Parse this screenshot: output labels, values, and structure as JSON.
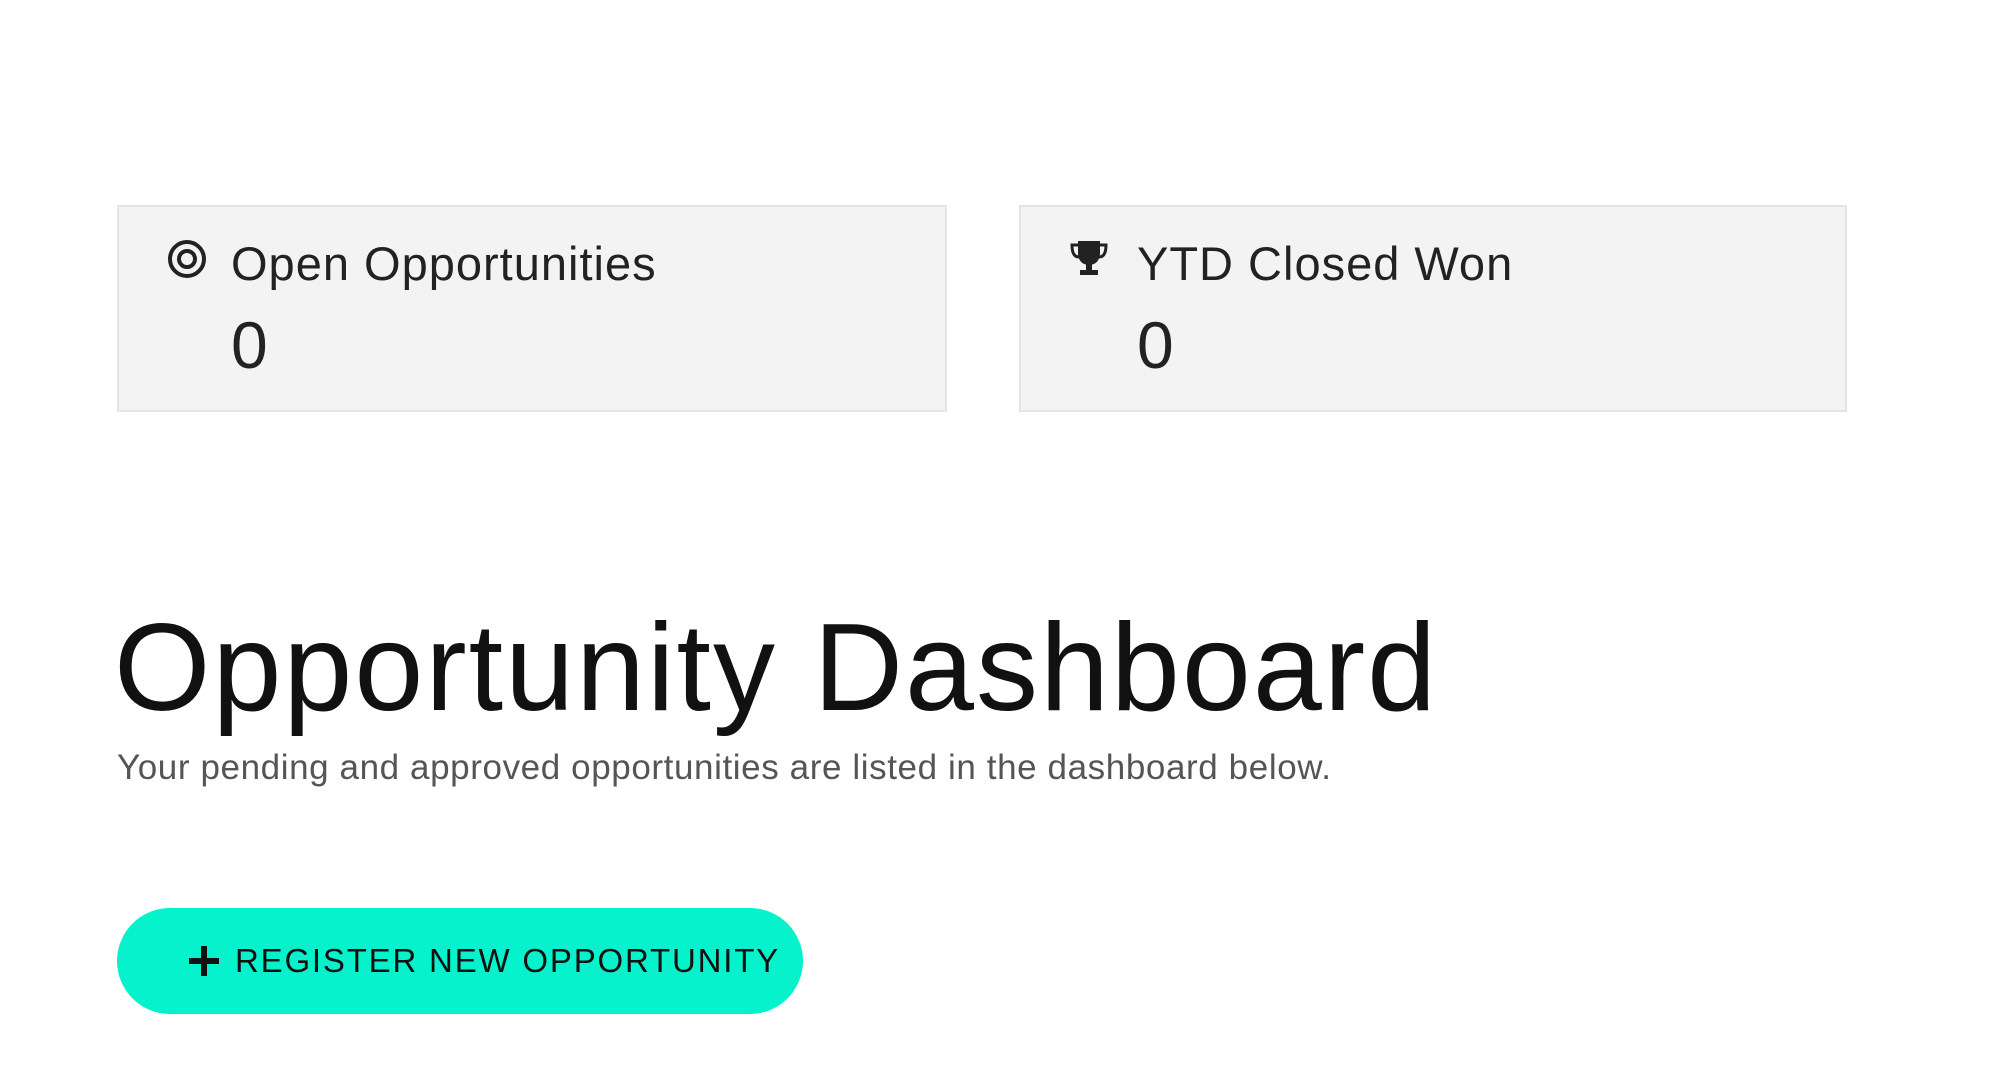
{
  "stats": {
    "open_opportunities": {
      "icon": "target-icon",
      "label": "Open Opportunities",
      "value": "0"
    },
    "ytd_closed_won": {
      "icon": "trophy-icon",
      "label": "YTD Closed Won",
      "value": "0"
    }
  },
  "dashboard": {
    "title": "Opportunity Dashboard",
    "subtitle": "Your pending and approved opportunities are listed in the dashboard below."
  },
  "actions": {
    "register_button": {
      "icon": "plus-icon",
      "label": "REGISTER NEW OPPORTUNITY",
      "color": "#06f2cd"
    }
  }
}
